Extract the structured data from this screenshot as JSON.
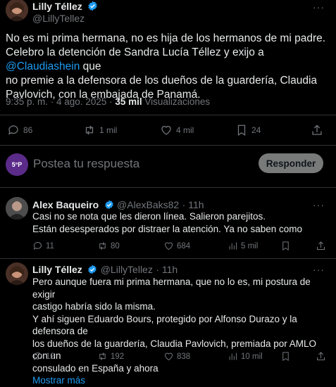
{
  "main_tweet": {
    "author_name": "Lilly Téllez",
    "author_handle": "@LillyTellez",
    "text_lines": [
      "No es mi prima hermana, no es hija de los hermanos de mi padre.",
      "Celebro la detención de Sandra Lucía Téllez y exijo a",
      "@Claudiashein",
      " que",
      "no premie a la defensora de los dueños de la guardería, Claudia",
      "Pavlovich, con la embajada de Panamá."
    ],
    "timestamp": "9:35 p. m. · 4 ago. 2025 · ",
    "views_count": "35 mil",
    "views_label": " Visualizaciones",
    "actions": {
      "replies": "86",
      "retweets": "1 mil",
      "likes": "4 mil",
      "bookmarks": "24"
    }
  },
  "composer": {
    "placeholder": "Postea tu respuesta",
    "button_label": "Responder",
    "avatar_text": "5°P"
  },
  "replies": [
    {
      "author_name": "Alex Baqueiro",
      "author_handle": "@AlexBaks82",
      "time": "· 11h",
      "lines": [
        "Casi no se nota que les dieron línea. Salieron parejitos.",
        "Están desesperados por distraer la atención. Ya no saben como"
      ],
      "actions": {
        "replies": "11",
        "retweets": "80",
        "likes": "684",
        "views": "5 mil"
      }
    },
    {
      "author_name": "Lilly Téllez",
      "author_handle": "@LillyTellez",
      "time": "· 11h",
      "lines": [
        "Pero aunque fuera mi prima hermana, que no lo es, mi postura de exigir",
        "castigo habría sido la misma.",
        "Y ahí siguen Eduardo Bours, protegido por Alfonso Durazo y la defensora de",
        "los dueños de la guardería, Claudia Pavlovich, premiada por AMLO con un",
        "consulado en España y ahora"
      ],
      "show_more": "Mostrar más",
      "actions": {
        "replies": "12",
        "retweets": "192",
        "likes": "838",
        "views": "10 mil"
      }
    }
  ],
  "colors": {
    "accent": "#1d9bf0",
    "background": "#000000",
    "muted": "#71767b",
    "divider": "#2f3336"
  }
}
